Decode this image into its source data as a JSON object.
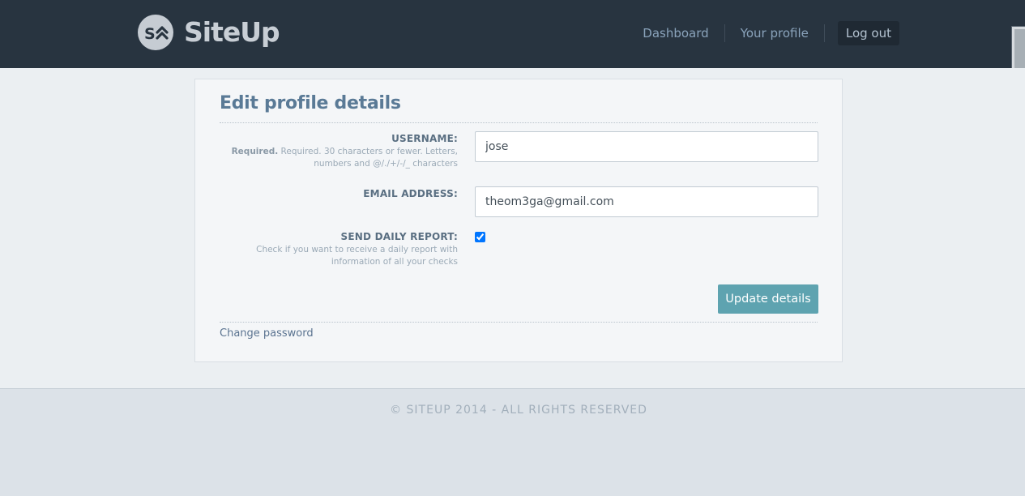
{
  "header": {
    "brand": "SiteUp",
    "logo_mark": "S",
    "nav": [
      {
        "label": "Dashboard"
      },
      {
        "label": "Your profile"
      }
    ],
    "logout_label": "Log out"
  },
  "form": {
    "title": "Edit profile details",
    "username": {
      "label": "USERNAME:",
      "help_required": "Required.",
      "help_text": "Required. 30 characters or fewer. Letters, numbers and @/./+/-/_ characters",
      "value": "jose"
    },
    "email": {
      "label": "EMAIL ADDRESS:",
      "value": "theom3ga@gmail.com"
    },
    "daily_report": {
      "label": "SEND DAILY REPORT:",
      "help_text": "Check if you want to receive a daily report with information of all your checks",
      "checked": true
    },
    "submit_label": "Update details",
    "change_password_label": "Change password"
  },
  "footer": {
    "text": "© SITEUP 2014 - ALL RIGHTS RESERVED"
  },
  "colors": {
    "header_bg": "#283440",
    "accent_button": "#5ea3b0",
    "title": "#5a7a96"
  }
}
